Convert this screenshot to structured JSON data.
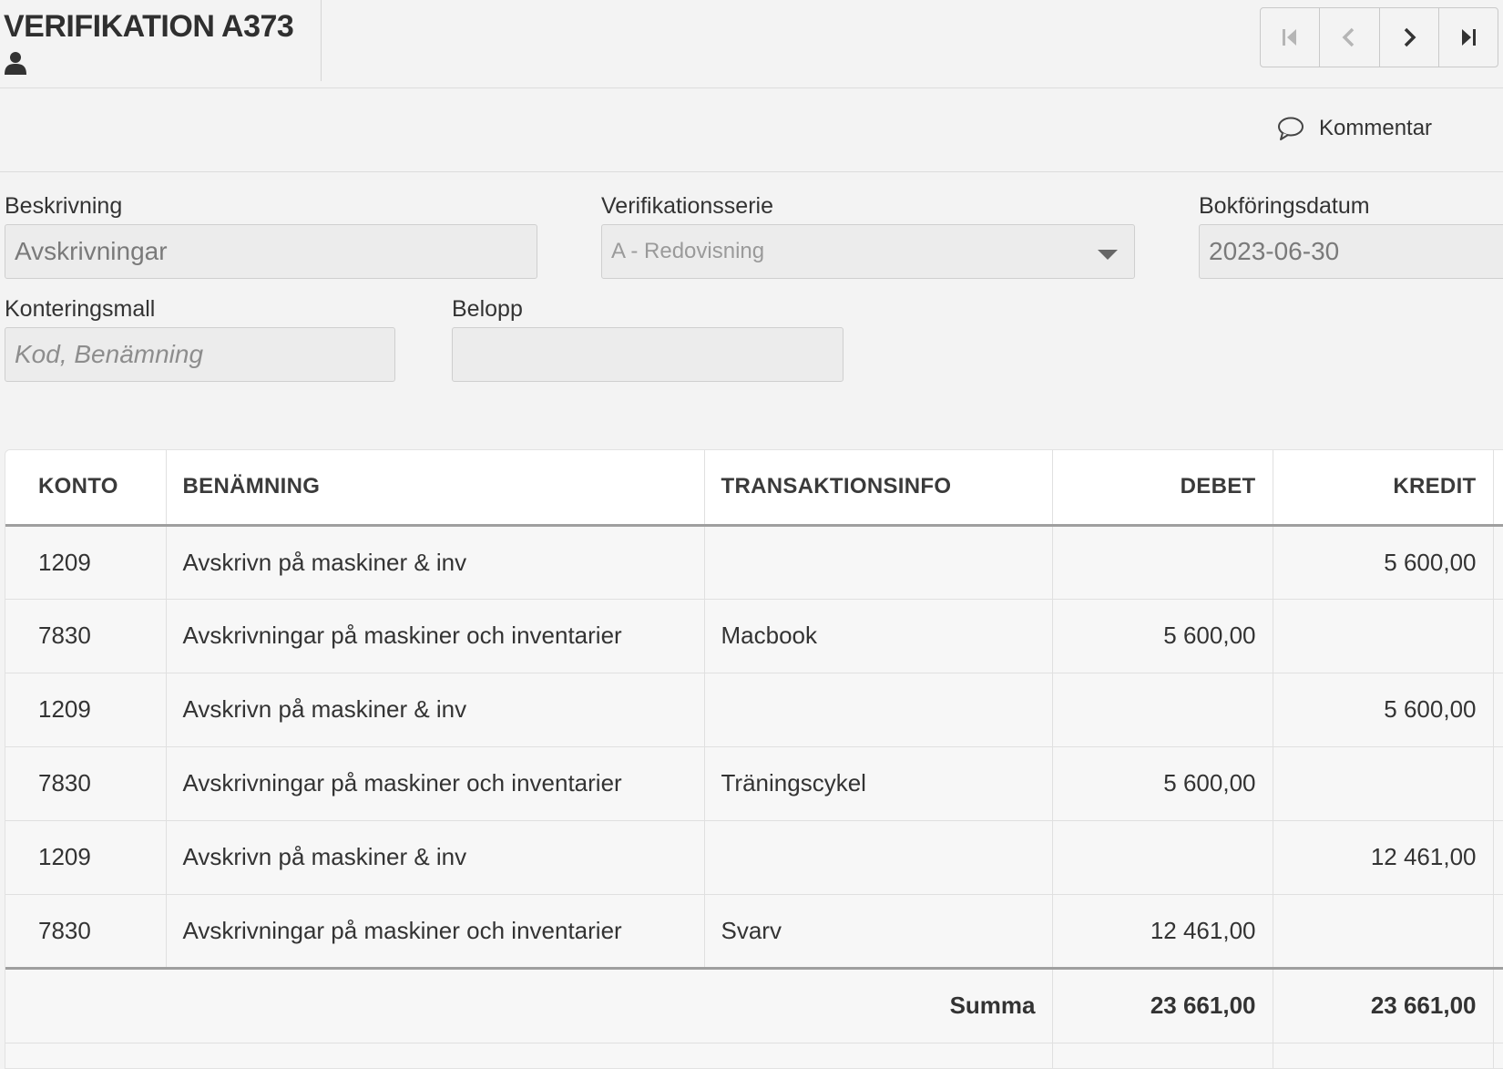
{
  "header": {
    "title": "VERIFIKATION A373",
    "nav": {
      "first": "first-page-icon",
      "prev": "chevron-left-icon",
      "next": "chevron-right-icon",
      "last": "last-page-icon"
    }
  },
  "toolbar": {
    "comment_label": "Kommentar"
  },
  "form": {
    "beskrivning_label": "Beskrivning",
    "beskrivning_value": "Avskrivningar",
    "serie_label": "Verifikationsserie",
    "serie_value": "A - Redovisning",
    "datum_label": "Bokföringsdatum",
    "datum_value": "2023-06-30",
    "mall_label": "Konteringsmall",
    "mall_placeholder": "Kod, Benämning",
    "belopp_label": "Belopp",
    "belopp_value": ""
  },
  "table": {
    "columns": [
      "KONTO",
      "BENÄMNING",
      "TRANSAKTIONSINFO",
      "DEBET",
      "KREDIT"
    ],
    "rows": [
      {
        "konto": "1209",
        "benamning": "Avskrivn på maskiner & inv",
        "info": "",
        "debet": "",
        "kredit": "5 600,00"
      },
      {
        "konto": "7830",
        "benamning": "Avskrivningar på maskiner och inventarier",
        "info": "Macbook",
        "debet": "5 600,00",
        "kredit": ""
      },
      {
        "konto": "1209",
        "benamning": "Avskrivn på maskiner & inv",
        "info": "",
        "debet": "",
        "kredit": "5 600,00"
      },
      {
        "konto": "7830",
        "benamning": "Avskrivningar på maskiner och inventarier",
        "info": "Träningscykel",
        "debet": "5 600,00",
        "kredit": ""
      },
      {
        "konto": "1209",
        "benamning": "Avskrivn på maskiner & inv",
        "info": "",
        "debet": "",
        "kredit": "12 461,00"
      },
      {
        "konto": "7830",
        "benamning": "Avskrivningar på maskiner och inventarier",
        "info": "Svarv",
        "debet": "12 461,00",
        "kredit": ""
      }
    ],
    "summa_label": "Summa",
    "summa_debet": "23 661,00",
    "summa_kredit": "23 661,00"
  }
}
